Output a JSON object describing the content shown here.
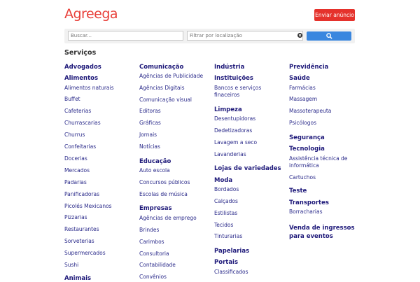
{
  "header": {
    "logo": "Agreega",
    "post_button": "Enviar anúncio"
  },
  "search": {
    "query_placeholder": "Buscar...",
    "location_placeholder": "Filtrar por localização",
    "clear_icon": "x-circle-icon",
    "search_icon": "magnifier-icon",
    "button_color": "#3a87df"
  },
  "section_title": "Serviços",
  "columns": [
    {
      "groups": [
        {
          "title": "Advogados",
          "items": []
        },
        {
          "title": "Alimentos",
          "items": [
            "Alimentos naturais",
            "Buffet",
            "Cafeterias",
            "Churrascarias",
            "Churrus",
            "Confeitarias",
            "Docerias",
            "Mercados",
            "Padarias",
            "Panificadoras",
            "Picolés Mexicanos",
            "Pizzarias",
            "Restaurantes",
            "Sorveterias",
            "Supermercados",
            "Sushi"
          ]
        },
        {
          "title": "Animais",
          "items": []
        }
      ]
    },
    {
      "groups": [
        {
          "title": "Comunicação",
          "items": [
            "Agências de Publicidade",
            "Agências Digitais",
            "Comunicação visual",
            "Editoras",
            "Gráficas",
            "Jornais",
            "Notícias"
          ]
        },
        {
          "title": "Educação",
          "items": [
            "Auto escola",
            "Concursos públicos",
            "Escolas de música"
          ]
        },
        {
          "title": "Empresas",
          "items": [
            "Agências de emprego",
            "Brindes",
            "Carimbos",
            "Consultoria",
            "Contabilidade",
            "Convênios"
          ]
        }
      ]
    },
    {
      "groups": [
        {
          "title": "Indústria",
          "items": []
        },
        {
          "title": "Instituições",
          "items": [
            "Bancos e serviços finaceiros"
          ]
        },
        {
          "title": "Limpeza",
          "items": [
            "Desentupidoras",
            "Dedetizadoras",
            "Lavagem a seco",
            "Lavanderias"
          ]
        },
        {
          "title": "Lojas de variedades",
          "items": []
        },
        {
          "title": "Moda",
          "items": [
            "Bordados",
            "Calçados",
            "Estilistas",
            "Tecidos",
            "Tinturarias"
          ]
        },
        {
          "title": "Papelarias",
          "items": []
        },
        {
          "title": "Portais",
          "items": [
            "Classificados"
          ]
        }
      ]
    },
    {
      "groups": [
        {
          "title": "Previdência",
          "items": []
        },
        {
          "title": "Saúde",
          "items": [
            "Farmácias",
            "Massagem",
            "Massoterapeuta",
            "Psicólogos"
          ]
        },
        {
          "title": "Segurança",
          "items": []
        },
        {
          "title": "Tecnologia",
          "items": [
            "Assistência técnica de informática",
            "Cartuchos"
          ]
        },
        {
          "title": "Teste",
          "items": []
        },
        {
          "title": "Transportes",
          "items": [
            "Borracharias"
          ]
        },
        {
          "title": "Venda de ingressos para eventos",
          "items": []
        }
      ]
    }
  ]
}
